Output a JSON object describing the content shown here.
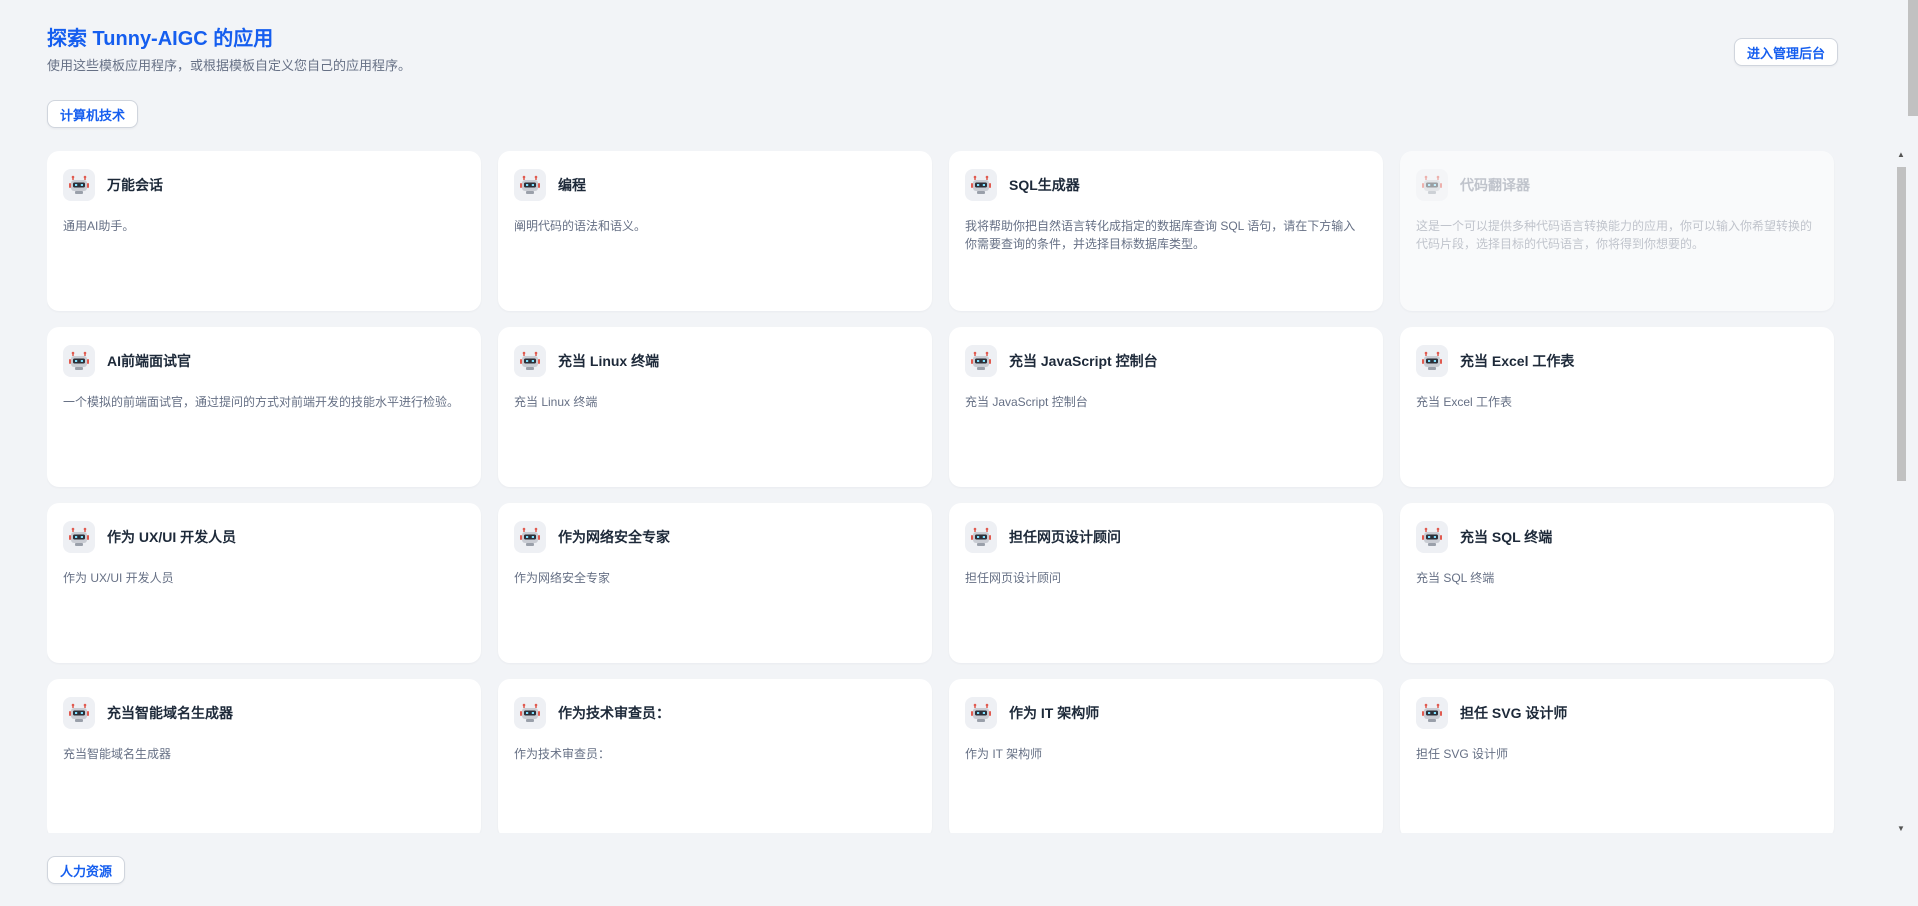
{
  "header": {
    "title": "探索 Tunny-AIGC 的应用",
    "subtitle": "使用这些模板应用程序，或根据模板自定义您自己的应用程序。",
    "admin_button": "进入管理后台"
  },
  "categories": [
    {
      "label": "计算机技术"
    },
    {
      "label": "人力资源"
    }
  ],
  "apps": [
    {
      "title": "万能会话",
      "desc": "通用AI助手。"
    },
    {
      "title": "编程",
      "desc": "阐明代码的语法和语义。"
    },
    {
      "title": "SQL生成器",
      "desc": "我将帮助你把自然语言转化成指定的数据库查询 SQL 语句，请在下方输入你需要查询的条件，并选择目标数据库类型。"
    },
    {
      "title": "代码翻译器",
      "desc": "这是一个可以提供多种代码语言转换能力的应用，你可以输入你希望转换的代码片段，选择目标的代码语言，你将得到你想要的。"
    },
    {
      "title": "AI前端面试官",
      "desc": "一个模拟的前端面试官，通过提问的方式对前端开发的技能水平进行检验。"
    },
    {
      "title": "充当 Linux 终端",
      "desc": "充当 Linux 终端"
    },
    {
      "title": "充当 JavaScript 控制台",
      "desc": "充当 JavaScript 控制台"
    },
    {
      "title": "充当 Excel 工作表",
      "desc": "充当 Excel 工作表"
    },
    {
      "title": "作为 UX/UI 开发人员",
      "desc": "作为 UX/UI 开发人员"
    },
    {
      "title": "作为网络安全专家",
      "desc": "作为网络安全专家"
    },
    {
      "title": "担任网页设计顾问",
      "desc": "担任网页设计顾问"
    },
    {
      "title": "充当 SQL 终端",
      "desc": "充当 SQL 终端"
    },
    {
      "title": "充当智能域名生成器",
      "desc": "充当智能域名生成器"
    },
    {
      "title": "作为技术审查员：",
      "desc": "作为技术审查员："
    },
    {
      "title": "作为 IT 架构师",
      "desc": "作为 IT 架构师"
    },
    {
      "title": "担任 SVG 设计师",
      "desc": "担任 SVG 设计师"
    }
  ],
  "icon": "robot-icon",
  "colors": {
    "accent": "#155eef",
    "background": "#f2f4f7",
    "card": "#ffffff"
  }
}
